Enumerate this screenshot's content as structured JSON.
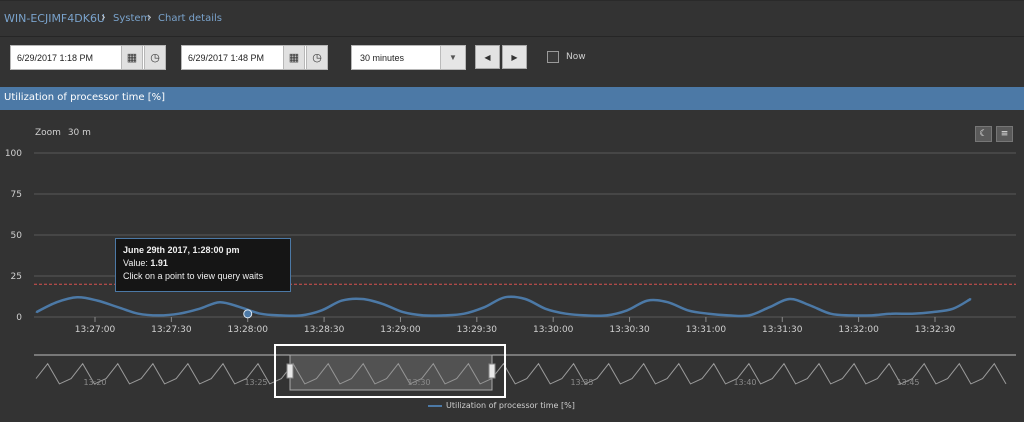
{
  "breadcrumb": {
    "host": "WIN-ECJIMF4DK6U",
    "section": "System",
    "page": "Chart details"
  },
  "toolbar": {
    "start": "6/29/2017 1:18 PM",
    "end": "6/29/2017 1:48 PM",
    "range": "30 minutes",
    "now_label": "Now",
    "now_checked": false
  },
  "panel_title": "Utilization of processor time [%]",
  "zoom": {
    "label": "Zoom",
    "value": "30 m"
  },
  "tooltip": {
    "date": "June 29th 2017, 1:28:00 pm",
    "value_label": "Value:",
    "value": "1.91",
    "hint": "Click on a point to view query waits"
  },
  "legend": "Utilization of processor time [%]",
  "colors": {
    "series": "#4c79a6",
    "threshold": "#d9534f",
    "title_bar": "#4c79a6",
    "background": "#333333"
  },
  "chart_data": {
    "type": "line",
    "ylim": [
      0,
      100
    ],
    "y_ticks": [
      0,
      25,
      50,
      75,
      100
    ],
    "x_ticks": [
      "13:27:00",
      "13:27:30",
      "13:28:00",
      "13:28:30",
      "13:29:00",
      "13:29:30",
      "13:30:00",
      "13:30:30",
      "13:31:00",
      "13:31:30",
      "13:32:00",
      "13:32:30"
    ],
    "threshold": 20,
    "series": [
      {
        "name": "Utilization of processor time [%]",
        "x": [
          "13:26:37",
          "13:26:45",
          "13:26:53",
          "13:27:01",
          "13:27:09",
          "13:27:17",
          "13:27:25",
          "13:27:33",
          "13:27:41",
          "13:27:49",
          "13:27:57",
          "13:28:05",
          "13:28:13",
          "13:28:21",
          "13:28:29",
          "13:28:37",
          "13:28:45",
          "13:28:53",
          "13:29:01",
          "13:29:09",
          "13:29:17",
          "13:29:25",
          "13:29:33",
          "13:29:41",
          "13:29:49",
          "13:29:57",
          "13:30:05",
          "13:30:13",
          "13:30:21",
          "13:30:29",
          "13:30:37",
          "13:30:45",
          "13:30:53",
          "13:31:01",
          "13:31:09",
          "13:31:17",
          "13:31:25",
          "13:31:33",
          "13:31:41",
          "13:31:49",
          "13:31:57",
          "13:32:05",
          "13:32:13",
          "13:32:21",
          "13:32:29",
          "13:32:37",
          "13:32:44"
        ],
        "values": [
          3,
          9,
          12,
          10,
          6,
          2,
          1,
          2,
          5,
          9,
          6,
          2,
          1,
          1,
          4,
          10,
          11,
          8,
          3,
          1,
          1,
          2,
          6,
          12,
          11,
          5,
          2,
          1,
          1,
          4,
          10,
          9,
          4,
          2,
          1,
          1,
          6,
          11,
          7,
          2,
          1,
          1,
          2,
          2,
          3,
          5,
          11
        ]
      }
    ],
    "navigator": {
      "x_labels": [
        "13:20",
        "13:25",
        "13:30",
        "13:35",
        "13:40",
        "13:45"
      ],
      "selection": [
        "13:26:37",
        "13:32:44"
      ]
    }
  }
}
